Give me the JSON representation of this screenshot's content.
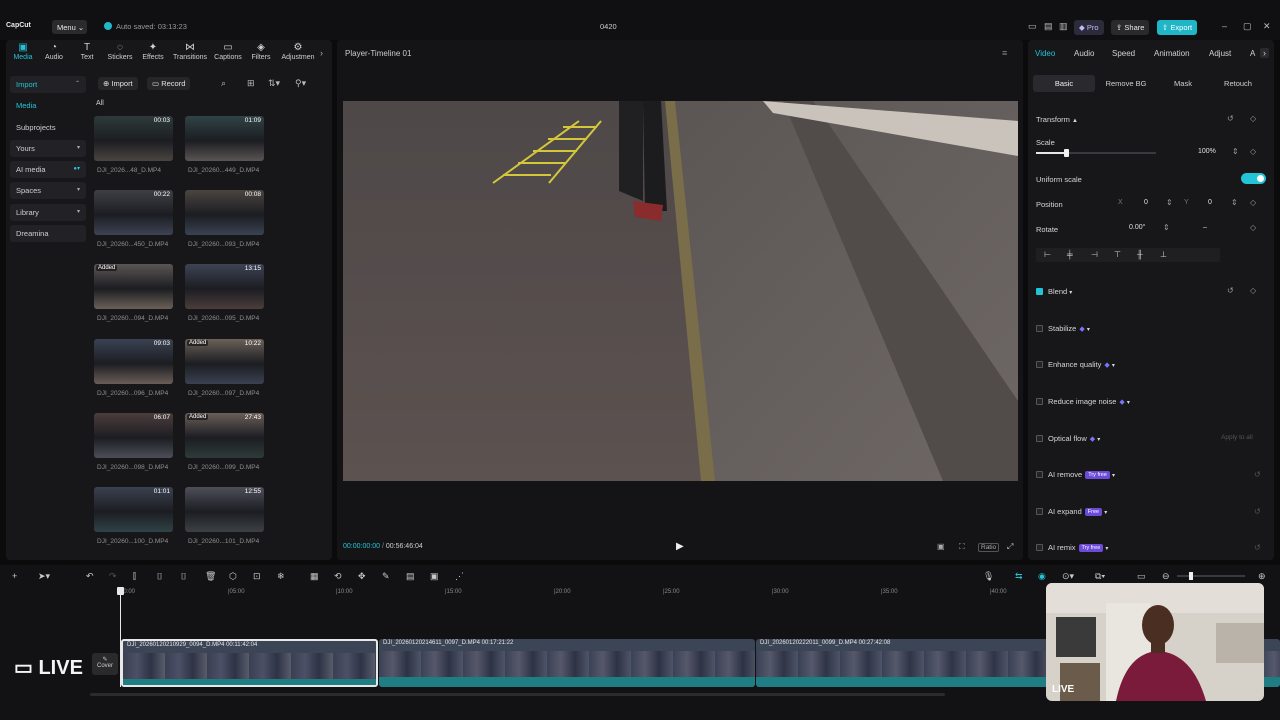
{
  "titlebar": {
    "logo": "CapCut",
    "menu_label": "Menu",
    "autosave": "Auto saved: 03:13:23",
    "project_title": "0420",
    "pro_label": "Pro",
    "share_label": "Share",
    "export_label": "Export"
  },
  "toolbar": {
    "tabs": [
      {
        "label": "Media",
        "icon": "media-icon"
      },
      {
        "label": "Audio",
        "icon": "audio-icon"
      },
      {
        "label": "Text",
        "icon": "text-icon"
      },
      {
        "label": "Stickers",
        "icon": "stickers-icon"
      },
      {
        "label": "Effects",
        "icon": "effects-icon"
      },
      {
        "label": "Transitions",
        "icon": "transitions-icon"
      },
      {
        "label": "Captions",
        "icon": "captions-icon"
      },
      {
        "label": "Filters",
        "icon": "filters-icon"
      },
      {
        "label": "Adjustmen",
        "icon": "adjustment-icon"
      }
    ]
  },
  "sidebar": {
    "items": [
      {
        "label": "Import"
      },
      {
        "label": "Media"
      },
      {
        "label": "Subprojects"
      },
      {
        "label": "Yours"
      },
      {
        "label": "AI media"
      },
      {
        "label": "Spaces"
      },
      {
        "label": "Library"
      },
      {
        "label": "Dreamina"
      }
    ]
  },
  "media": {
    "import_label": "Import",
    "record_label": "Record",
    "filter_label": "All",
    "items": [
      {
        "name": "DJI_2026...48_D.MP4",
        "duration": "00:03",
        "added": ""
      },
      {
        "name": "DJI_20260...449_D.MP4",
        "duration": "01:09",
        "added": ""
      },
      {
        "name": "DJI_20260...450_D.MP4",
        "duration": "00:22",
        "added": ""
      },
      {
        "name": "DJI_20260...093_D.MP4",
        "duration": "00:08",
        "added": ""
      },
      {
        "name": "DJI_20260...094_D.MP4",
        "duration": "",
        "added": "Added"
      },
      {
        "name": "DJI_20260...095_D.MP4",
        "duration": "13:15",
        "added": ""
      },
      {
        "name": "DJI_20260...096_D.MP4",
        "duration": "09:03",
        "added": ""
      },
      {
        "name": "DJI_20260...097_D.MP4",
        "duration": "10:22",
        "added": "Added"
      },
      {
        "name": "DJI_20260...098_D.MP4",
        "duration": "06:07",
        "added": ""
      },
      {
        "name": "DJI_20260...099_D.MP4",
        "duration": "27:43",
        "added": "Added"
      },
      {
        "name": "DJI_20260...100_D.MP4",
        "duration": "01:01",
        "added": ""
      },
      {
        "name": "DJI_20260...101_D.MP4",
        "duration": "12:55",
        "added": ""
      }
    ]
  },
  "player": {
    "title": "Player-Timeline 01",
    "current_time": "00:00:00:00",
    "total_time": "00:56:46:04",
    "ratio_label": "Ratio"
  },
  "inspector": {
    "tabs": [
      "Video",
      "Audio",
      "Speed",
      "Animation",
      "Adjust",
      "A"
    ],
    "subtabs": [
      "Basic",
      "Remove BG",
      "Mask",
      "Retouch"
    ],
    "transform_label": "Transform",
    "scale_label": "Scale",
    "scale_value": "100%",
    "scale_fraction": 0.25,
    "uniform_label": "Uniform scale",
    "position_label": "Position",
    "pos_x_label": "X",
    "pos_x": "0",
    "pos_y_label": "Y",
    "pos_y": "0",
    "rotate_label": "Rotate",
    "rotate_value": "0.00°",
    "rotate_dash": "–",
    "blend_label": "Blend",
    "stabilize_label": "Stabilize",
    "enhance_label": "Enhance quality",
    "noise_label": "Reduce image noise",
    "optical_label": "Optical flow",
    "apply_all": "Apply to all",
    "ai_remove_label": "AI remove",
    "ai_remove_badge": "Try free",
    "ai_expand_label": "AI expand",
    "ai_expand_badge": "Free",
    "ai_remix_label": "AI remix",
    "ai_remix_badge": "Try free"
  },
  "timeline": {
    "ruler": [
      "00:00",
      "|05:00",
      "|10:00",
      "|15:00",
      "|20:00",
      "|25:00",
      "|30:00",
      "|35:00",
      "|40:00"
    ],
    "clips": [
      {
        "label": "DJI_20260120210929_0094_D.MP4   00:11:42:04"
      },
      {
        "label": "DJI_20260120214611_0097_D.MP4   00:17:21:22"
      },
      {
        "label": "DJI_20260120222011_0099_D.MP4   00:27:42:08"
      }
    ],
    "cover_label": "Cover",
    "live_label": "LIVE"
  },
  "colors": {
    "accent": "#22c4d6",
    "panel": "#17171a",
    "bg": "#0b0b0c"
  }
}
